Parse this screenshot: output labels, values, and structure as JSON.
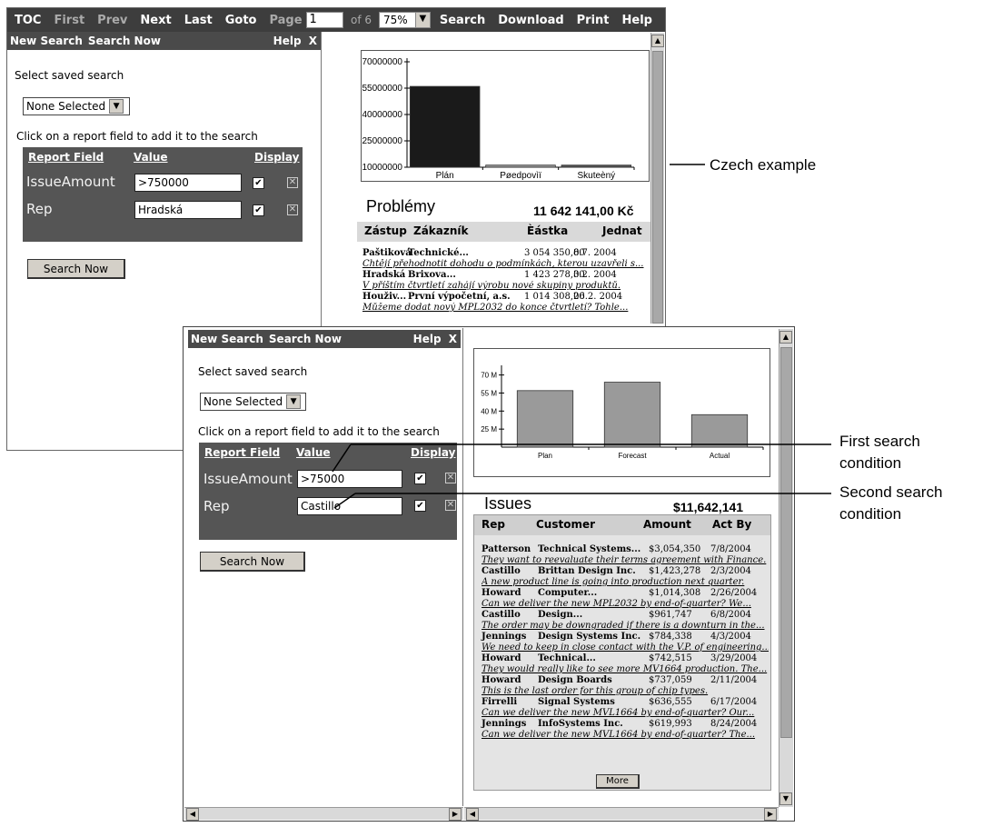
{
  "toolbar": {
    "toc": "TOC",
    "first": "First",
    "prev": "Prev",
    "next": "Next",
    "last": "Last",
    "goto": "Goto",
    "page_label": "Page",
    "page_value": "1",
    "of": "of 6",
    "zoom": "75%",
    "search": "Search",
    "download": "Download",
    "print": "Print",
    "help": "Help"
  },
  "czech": {
    "panel": {
      "new_search": "New Search",
      "search_now": "Search Now",
      "help": "Help",
      "close": "X",
      "saved_label": "Select saved search",
      "saved_value": "None Selected",
      "click_label": "Click on a report field to add it to the search",
      "col_value": "Value",
      "col_field": "Report Field",
      "col_display": "Display",
      "rows": [
        {
          "field": "IssueAmount",
          "value": ">750000"
        },
        {
          "field": "Rep",
          "value": "Hradská"
        }
      ],
      "button": "Search Now"
    },
    "chart_data": {
      "type": "bar",
      "categories": [
        "Plán",
        "Pøedpovìï",
        "Skuteèný"
      ],
      "values": [
        56000000,
        4000000,
        4000000
      ],
      "yticks": [
        "70000000",
        "55000000",
        "40000000",
        "25000000",
        "10000000"
      ],
      "ylim": [
        10000000,
        70000000
      ],
      "colors": [
        "#1a1a1a",
        "#9a9a9a",
        "#555555"
      ]
    },
    "report": {
      "title": "Problémy",
      "total": "11 642 141,00 Kč",
      "headers": [
        "Zástup",
        "Zákazník",
        "Èástka",
        "Jednat"
      ],
      "rows": [
        {
          "rep": "Paštiková",
          "customer": "Technické...",
          "amount": "3 054 350,00",
          "date": "8.7. 2004",
          "note": "Chtějí přehodnotit dohodu o podmínkách, kterou uzavřeli s..."
        },
        {
          "rep": "Hradská",
          "customer": "Brixova...",
          "amount": "1 423 278,00",
          "date": "3.2. 2004",
          "note": "V příštím čtvrtletí zahájí výrobu nové skupiny produktů."
        },
        {
          "rep": "Houživ...",
          "customer": "První výpočetní, a.s.",
          "amount": "1 014 308,00",
          "date": "26.2. 2004",
          "note": "Můžeme dodat nový MPL2032 do konce čtvrtletí? Tohle..."
        }
      ]
    }
  },
  "english": {
    "panel": {
      "new_search": "New Search",
      "search_now": "Search Now",
      "help": "Help",
      "close": "X",
      "saved_label": "Select saved search",
      "saved_value": "None Selected",
      "click_label": "Click on a report field to add it to the search",
      "col_field": "Report Field",
      "col_value": "Value",
      "col_display": "Display",
      "rows": [
        {
          "field": "IssueAmount",
          "value": ">75000"
        },
        {
          "field": "Rep",
          "value": "Castillo"
        }
      ],
      "button": "Search Now"
    },
    "chart_data": {
      "type": "bar",
      "categories": [
        "Plan",
        "Forecast",
        "Actual"
      ],
      "values": [
        57000000,
        64000000,
        37000000
      ],
      "yticks": [
        "70 M",
        "55 M",
        "40 M",
        "25 M"
      ],
      "ylim": [
        10000000,
        75000000
      ],
      "colors": [
        "#9a9a9a",
        "#9a9a9a",
        "#9a9a9a"
      ]
    },
    "report": {
      "title": "Issues",
      "total": "$11,642,141",
      "headers": [
        "Rep",
        "Customer",
        "Amount",
        "Act By"
      ],
      "rows": [
        {
          "rep": "Patterson",
          "customer": "Technical Systems...",
          "amount": "$3,054,350",
          "date": "7/8/2004",
          "note": "They want to reevaluate their terms agreement with Finance."
        },
        {
          "rep": "Castillo",
          "customer": "Brittan Design Inc.",
          "amount": "$1,423,278",
          "date": "2/3/2004",
          "note": "A new product line is going into production next quarter."
        },
        {
          "rep": "Howard",
          "customer": "Computer...",
          "amount": "$1,014,308",
          "date": "2/26/2004",
          "note": "Can we deliver the new MPL2032 by end-of-quarter? We..."
        },
        {
          "rep": "Castillo",
          "customer": "Design...",
          "amount": "$961,747",
          "date": "6/8/2004",
          "note": "The order may be downgraded if there is a downturn in the..."
        },
        {
          "rep": "Jennings",
          "customer": "Design Systems Inc.",
          "amount": "$784,338",
          "date": "4/3/2004",
          "note": "We need to keep in close contact with the V.P. of engineering..."
        },
        {
          "rep": "Howard",
          "customer": "Technical...",
          "amount": "$742,515",
          "date": "3/29/2004",
          "note": "They would really like to see more MV1664 production. The..."
        },
        {
          "rep": "Howard",
          "customer": "Design Boards",
          "amount": "$737,059",
          "date": "2/11/2004",
          "note": "This is the last order for this group of chip types."
        },
        {
          "rep": "Firrelli",
          "customer": "Signal Systems",
          "amount": "$636,555",
          "date": "6/17/2004",
          "note": "Can we deliver the new MVL1664 by end-of-quarter? Our..."
        },
        {
          "rep": "Jennings",
          "customer": "InfoSystems Inc.",
          "amount": "$619,993",
          "date": "8/24/2004",
          "note": "Can we deliver the new MVL1664 by end-of-quarter? The..."
        }
      ],
      "more": "More"
    }
  },
  "callouts": {
    "czech": "Czech example",
    "first": [
      "First search",
      "condition"
    ],
    "second": [
      "Second search",
      "condition"
    ]
  }
}
